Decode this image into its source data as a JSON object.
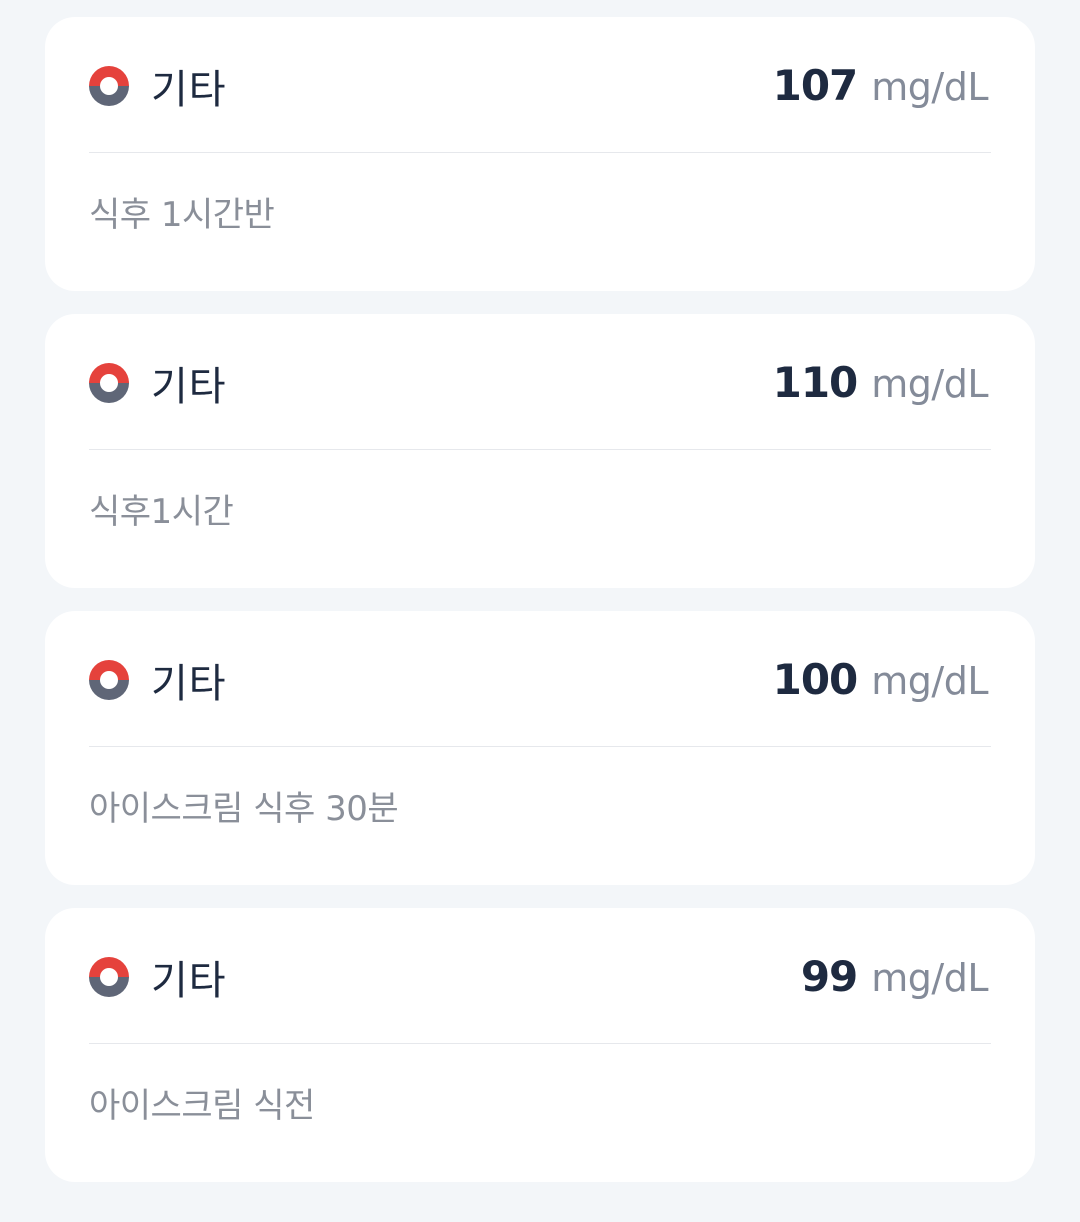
{
  "records": [
    {
      "type_label": "기타",
      "value": "107",
      "unit": "mg/dL",
      "memo": "식후 1시간반",
      "icon": "glucose-record-icon"
    },
    {
      "type_label": "기타",
      "value": "110",
      "unit": "mg/dL",
      "memo": "식후1시간",
      "icon": "glucose-record-icon"
    },
    {
      "type_label": "기타",
      "value": "100",
      "unit": "mg/dL",
      "memo": "아이스크림 식후 30분",
      "icon": "glucose-record-icon"
    },
    {
      "type_label": "기타",
      "value": "99",
      "unit": "mg/dL",
      "memo": "아이스크림 식전",
      "icon": "glucose-record-icon"
    }
  ],
  "colors": {
    "background": "#f3f6f9",
    "card": "#ffffff",
    "icon_top": "#e5423c",
    "icon_bottom": "#5f6677",
    "value_text": "#1e2a40",
    "unit_text": "#848b99",
    "memo_text": "#8a8f99"
  }
}
